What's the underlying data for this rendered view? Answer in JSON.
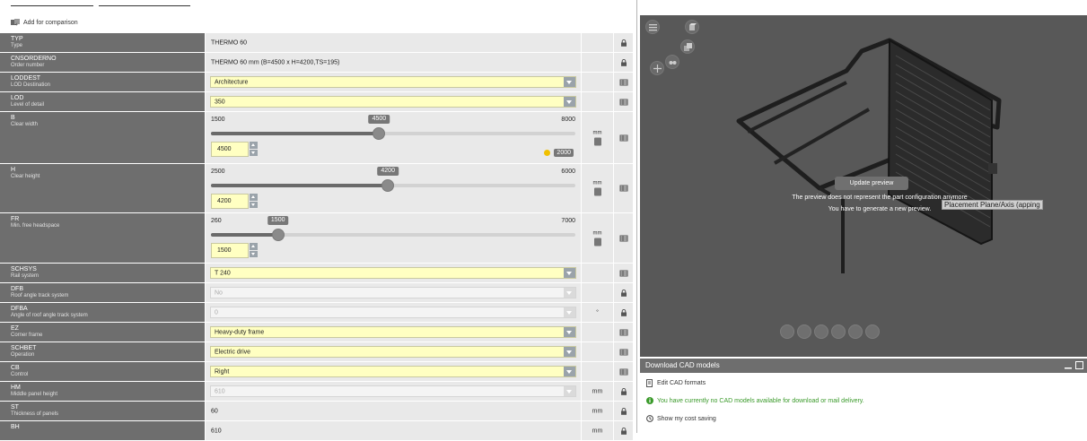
{
  "compare": {
    "label": "Add for comparison"
  },
  "rows": [
    {
      "code": "TYP",
      "desc": "Type",
      "value": "THERMO 60",
      "kind": "text",
      "icon": "lock-icon"
    },
    {
      "code": "CNSORDERNO",
      "desc": "Order number",
      "value": "THERMO 60 mm (B=4500 x H=4200,TS=195)",
      "kind": "text",
      "icon": "lock-icon"
    },
    {
      "code": "LODDEST",
      "desc": "LOD Destination",
      "value": "Architecture",
      "kind": "select",
      "icon": "table-icon"
    },
    {
      "code": "LOD",
      "desc": "Level of detail",
      "value": "350",
      "kind": "select",
      "icon": "table-icon"
    },
    {
      "code": "B",
      "desc": "Clear width",
      "kind": "slider",
      "min": "1500",
      "max": "8000",
      "current": "4500",
      "fraction": 0.4615,
      "unit": "mm",
      "hint": "2000",
      "icon": "table-icon"
    },
    {
      "code": "H",
      "desc": "Clear height",
      "kind": "slider",
      "min": "2500",
      "max": "6000",
      "current": "4200",
      "fraction": 0.4857,
      "unit": "mm",
      "icon": "table-icon"
    },
    {
      "code": "FR",
      "desc": "Min. free headspace",
      "kind": "slider",
      "min": "260",
      "max": "7000",
      "current": "1500",
      "fraction": 0.184,
      "unit": "mm",
      "icon": "table-icon"
    },
    {
      "code": "SCHSYS",
      "desc": "Rail system",
      "value": "T 240",
      "kind": "select",
      "icon": "table-icon"
    },
    {
      "code": "DFB",
      "desc": "Roof angle track system",
      "value": "No",
      "kind": "select-disabled",
      "icon": "lock-icon"
    },
    {
      "code": "DFBA",
      "desc": "Angle of roof angle track system",
      "value": "0",
      "kind": "select-disabled",
      "unit": "°",
      "icon": "lock-icon"
    },
    {
      "code": "EZ",
      "desc": "Corner frame",
      "value": "Heavy-duty frame",
      "kind": "select",
      "icon": "table-icon"
    },
    {
      "code": "SCHBET",
      "desc": "Operation",
      "value": "Electric drive",
      "kind": "select",
      "icon": "table-icon"
    },
    {
      "code": "CB",
      "desc": "Control",
      "value": "Right",
      "kind": "select",
      "icon": "table-icon"
    },
    {
      "code": "HM",
      "desc": "Middle panel height",
      "value": "610",
      "kind": "select-disabled",
      "unit": "mm",
      "icon": "lock-icon"
    },
    {
      "code": "ST",
      "desc": "Thickness of panels",
      "value": "60",
      "kind": "text",
      "unit": "mm",
      "icon": "lock-icon"
    },
    {
      "code": "BH",
      "desc": "",
      "value": "610",
      "kind": "text",
      "unit": "mm",
      "icon": "lock-icon"
    }
  ],
  "preview": {
    "update_label": "Update preview",
    "message_line1": "The preview does not represent the part configuration anymore",
    "message_line2": "You have to generate a new preview.",
    "placement_label": "Placement Plane/Axis (apping"
  },
  "download": {
    "title": "Download CAD models",
    "edit_formats": "Edit CAD formats",
    "status": "You have currently no CAD models available for download or mail delivery.",
    "cost_saving": "Show my cost saving",
    "status_color": "#3a9a2a"
  }
}
